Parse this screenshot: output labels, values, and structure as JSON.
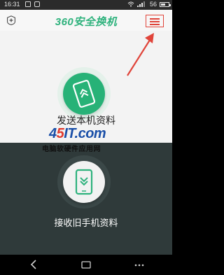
{
  "status_bar": {
    "time": "16:31",
    "battery_percent": "56"
  },
  "header": {
    "title": "360安全换机",
    "settings_icon": "settings-plus-icon",
    "menu_icon": "hamburger-menu-icon"
  },
  "send_section": {
    "label": "发送本机资料",
    "icon": "phone-send-icon"
  },
  "receive_section": {
    "label": "接收旧手机资料",
    "icon": "phone-receive-icon"
  },
  "watermark": {
    "brand_prefix": "4",
    "brand_red": "5",
    "brand_rest": "IT.com",
    "tagline": "电脑软硬件应用网"
  },
  "navigation": {
    "back_icon": "back-icon",
    "home_icon": "home-icon",
    "more_icon": "more-icon"
  },
  "colors": {
    "accent_green": "#27b277",
    "annotation_red": "#e0443a",
    "dark_panel": "#2f3a3a"
  }
}
